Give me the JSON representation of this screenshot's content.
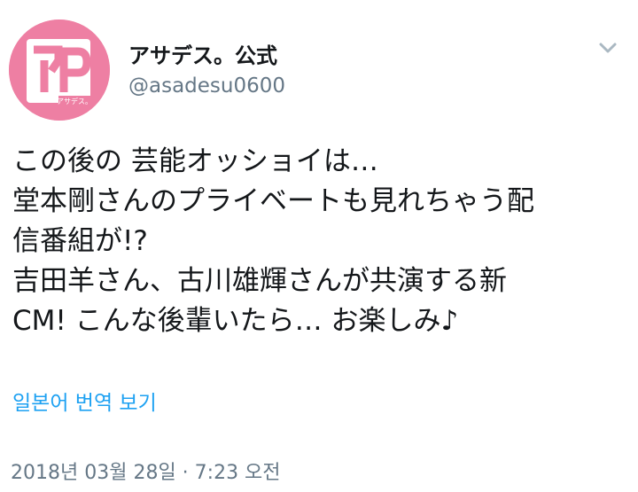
{
  "profile": {
    "display_name": "アサデス。公式",
    "handle": "@asadesu0600",
    "avatar_icon": "asadesu-logo-icon",
    "avatar_logo_text": "アサデス。",
    "avatar_color": "#ee7fa3"
  },
  "menu": {
    "icon": "chevron-down-icon"
  },
  "tweet": {
    "lines": [
      "この後の  芸能オッショイは…",
      "堂本剛さんのプライベートも見れちゃう配",
      "信番組が!?",
      "吉田羊さん、古川雄輝さんが共演する新",
      "CM! こんな後輩いたら… お楽しみ♪"
    ],
    "translate_label": "일본어 번역 보기",
    "timestamp": "2018년 03월 28일 · 7:23 오전"
  },
  "colors": {
    "text": "#14171a",
    "secondary_text": "#657786",
    "link": "#1da1f2",
    "chevron": "#aab8c2"
  }
}
